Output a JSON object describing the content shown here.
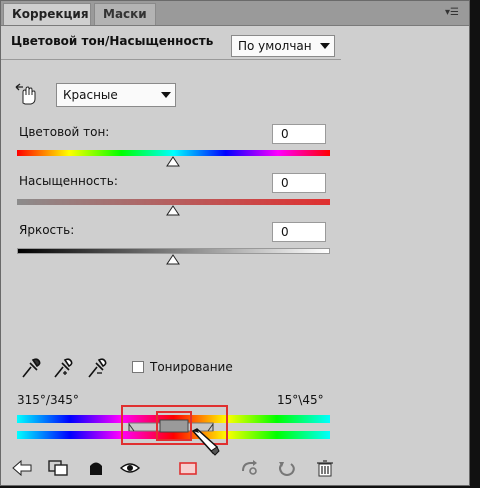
{
  "tabs": [
    {
      "label": "Коррекция"
    },
    {
      "label": "Маски"
    }
  ],
  "title": "Цветовой тон/Насыщенность",
  "preset_value": "По умолчан",
  "channel_value": "Красные",
  "sliders": [
    {
      "label": "Цветовой тон:",
      "value": "0",
      "level": 0.5
    },
    {
      "label": "Насыщенность:",
      "value": "0",
      "level": 0.5
    },
    {
      "label": "Яркость:",
      "value": "0",
      "level": 0.5
    }
  ],
  "colorize_label": "Тонирование",
  "colorize_checked": false,
  "range_left": "315°/345°",
  "range_right": "15°\\45°",
  "icons": [
    "hand-target-icon",
    "eyedropper-icon",
    "eyedropper-plus-icon",
    "eyedropper-minus-icon",
    "back-arrow-icon",
    "clip-layer-icon",
    "mask-icon",
    "eye-icon",
    "reset-view-icon",
    "cycle-icon",
    "undo-icon",
    "trash-icon",
    "panel-menu-icon"
  ],
  "colors": {
    "panel_bg": "#cfcfcf",
    "highlight": "#e03030"
  }
}
